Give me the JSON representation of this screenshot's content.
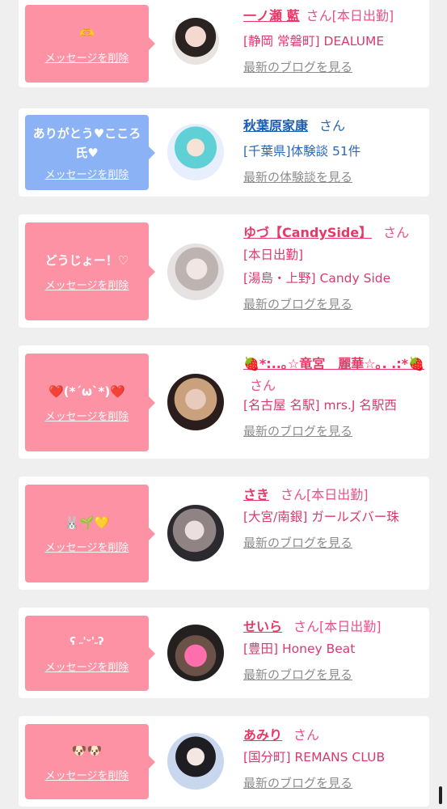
{
  "cards": [
    {
      "message": "🫶",
      "delete_label": "メッセージを削除",
      "name": "一ノ瀬 藍",
      "san": "さん[本日出勤]",
      "lines": [
        "[静岡 常磐町] DEALUME"
      ],
      "more": "最新のブログを見る"
    },
    {
      "message": "ありがとう♥こころ氏♥",
      "delete_label": "メッセージを削除",
      "name": "秋葉原家康",
      "san": "さん",
      "lines": [
        "[千葉県]体験談 51件"
      ],
      "more": "最新の体験談を見る"
    },
    {
      "message": "どうじょー！♡",
      "delete_label": "メッセージを削除",
      "name": "ゆづ【CandySide】",
      "san": "さん",
      "lines": [
        "[本日出勤]",
        "[湯島・上野] Candy Side"
      ],
      "more": "最新のブログを見る"
    },
    {
      "message": "❤️(*´ω`*)❤️",
      "delete_label": "メッセージを削除",
      "name": "🍓*:..｡☆竜宮　麗華☆｡. .:*🍓",
      "san": "さん",
      "lines": [
        "[名古屋 名駅] mrs.J 名駅西"
      ],
      "more": "最新のブログを見る"
    },
    {
      "message": "🐰🌱💛",
      "delete_label": "メッセージを削除",
      "name": "さき",
      "san": "さん[本日出勤]",
      "lines": [
        "[大宮/南銀] ガールズバー珠"
      ],
      "more": "最新のブログを見る"
    },
    {
      "message": "ʕ ˶'ᵕ'˶ʔ",
      "delete_label": "メッセージを削除",
      "name": "せいら",
      "san": "さん[本日出勤]",
      "lines": [
        "[豊田] Honey Beat"
      ],
      "more": "最新のブログを見る"
    },
    {
      "message": "🐶🐶",
      "delete_label": "メッセージを削除",
      "name": "あみり",
      "san": "さん",
      "lines": [
        "[国分町] REMANS CLUB"
      ],
      "more": "最新のブログを見る"
    }
  ]
}
